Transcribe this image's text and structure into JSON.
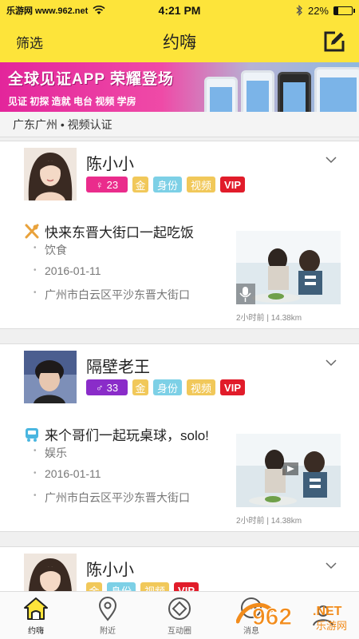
{
  "status": {
    "carrier": "乐游网 www.962.net",
    "time": "4:21 PM",
    "battery": "22%",
    "battery_level": 0.22
  },
  "nav": {
    "left_label": "筛选",
    "title": "约嗨"
  },
  "banner": {
    "headline": "全球见证APP 荣耀登场",
    "subline": "见证 初探 造就 电台 视频 学房"
  },
  "location": {
    "label": "广东广州 • 视频认证"
  },
  "cards": [
    {
      "name": "陈小小",
      "gender_symbol": "♀",
      "age": "23",
      "gender_color": "#ea2c8c",
      "gold_label": "金",
      "id_label": "身份",
      "video_label": "视频",
      "vip_label": "VIP",
      "activity": "快来东晋大街口一起吃饭",
      "activity_icon": "utensils-icon",
      "category": "饮食",
      "date": "2016-01-11",
      "address": "广州市白云区平沙东晋大街口",
      "meta": "2小时前 | 14.38km"
    },
    {
      "name": "隔壁老王",
      "gender_symbol": "♂",
      "age": "33",
      "gender_color": "#8a2cc9",
      "gold_label": "金",
      "id_label": "身份",
      "video_label": "视频",
      "vip_label": "VIP",
      "activity": "来个哥们一起玩桌球，solo!",
      "activity_icon": "game-controller-icon",
      "category": "娱乐",
      "date": "2016-01-11",
      "address": "广州市白云区平沙东晋大街口",
      "meta": "2小时前 | 14.38km"
    },
    {
      "name": "陈小小",
      "gold_label": "金",
      "id_label": "身份",
      "video_label": "视频",
      "vip_label": "VIP"
    }
  ],
  "tabs": [
    {
      "label": "约嗨",
      "icon": "home-icon",
      "active": true
    },
    {
      "label": "附近",
      "icon": "location-pin-icon",
      "active": false
    },
    {
      "label": "互动圈",
      "icon": "interaction-icon",
      "active": false
    },
    {
      "label": "消息",
      "icon": "message-icon",
      "active": false
    },
    {
      "label": "",
      "icon": "profile-icon",
      "active": false
    }
  ],
  "watermark": {
    "logo_text": "962",
    "domain": ".NET",
    "caption": "乐游网"
  },
  "colors": {
    "brand_yellow": "#fde43a",
    "vip_red": "#e11c2a",
    "gold": "#f1c85a",
    "id_cyan": "#7dd0e6"
  }
}
